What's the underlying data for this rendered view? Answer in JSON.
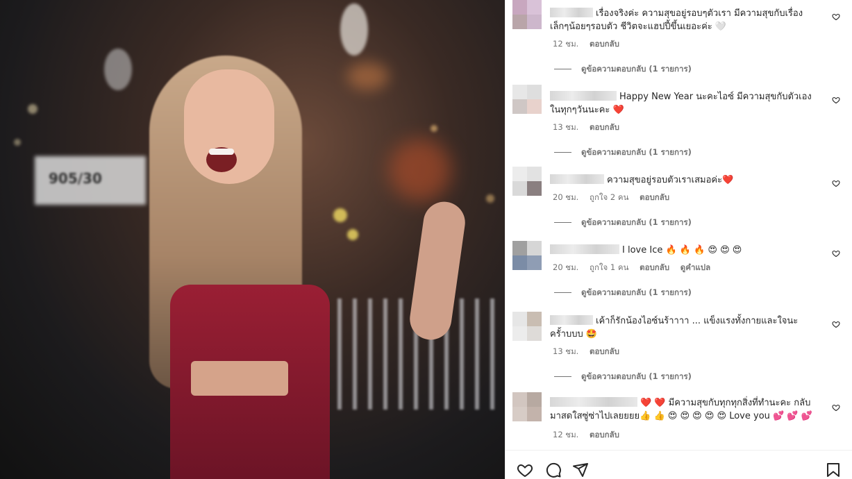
{
  "comments": [
    {
      "text": "เรื่องจริงค่ะ ความสุขอยู่รอบๆตัวเรา มีความสุขกับเรื่องเล็กๆน้อยๆรอบตัว ชีวิตจะแฮปปี้ขึ้นเยอะค่ะ 🤍",
      "time": "12 ชม.",
      "likes": "",
      "reply": "ตอบกลับ",
      "translate": "",
      "view_replies": "ดูข้อความตอบกลับ (1 รายการ)"
    },
    {
      "text": "Happy New Year นะคะไอซ์ มีความสุขกับตัวเองในทุกๆวันนะคะ ❤️",
      "time": "13 ชม.",
      "likes": "",
      "reply": "ตอบกลับ",
      "translate": "",
      "view_replies": "ดูข้อความตอบกลับ (1 รายการ)"
    },
    {
      "text": "ความสุขอยู่รอบตัวเราเสมอค่ะ❤️",
      "time": "20 ชม.",
      "likes": "ถูกใจ 2 คน",
      "reply": "ตอบกลับ",
      "translate": "",
      "view_replies": "ดูข้อความตอบกลับ (1 รายการ)"
    },
    {
      "text": "I love Ice 🔥 🔥 🔥 😍 😍 😍",
      "time": "20 ชม.",
      "likes": "ถูกใจ 1 คน",
      "reply": "ตอบกลับ",
      "translate": "ดูคำแปล",
      "view_replies": "ดูข้อความตอบกลับ (1 รายการ)"
    },
    {
      "text": "เค้าก็รักน้องไอซ์นร้าาาา ... แข็งแรงทั้งกายและใจนะครั้าบบบ 🤩",
      "time": "13 ชม.",
      "likes": "",
      "reply": "ตอบกลับ",
      "translate": "",
      "view_replies": "ดูข้อความตอบกลับ (1 รายการ)"
    },
    {
      "text": "❤️ ❤️ มีความสุขกับทุกทุกสิ่งที่ทำนะคะ กลับมาสดใสซู่ซ่าไปเลยยยย👍 👍 😍 😍 😍 😍 😍 Love you 💕 💕 💕",
      "time": "12 ชม.",
      "likes": "",
      "reply": "ตอบกลับ",
      "translate": "",
      "view_replies": ""
    }
  ],
  "photo": {
    "sign_text": "905/30"
  },
  "icons": {
    "like": "heart-icon",
    "comment": "comment-icon",
    "share": "send-icon",
    "save": "bookmark-icon",
    "comment_like": "heart-outline-icon"
  }
}
